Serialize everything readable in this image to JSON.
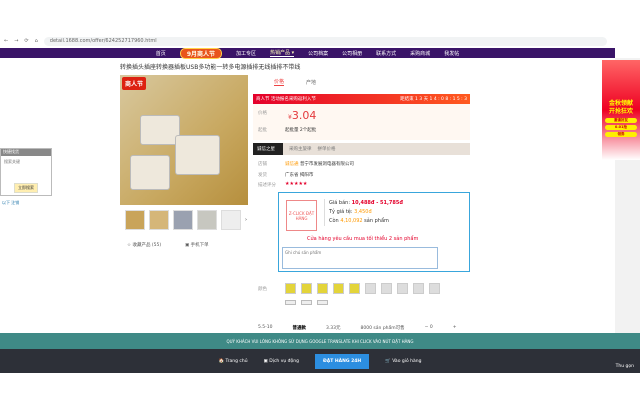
{
  "browser": {
    "url": "detail.1688.com/offer/624252717960.html"
  },
  "nav": {
    "items": [
      "首页",
      "9月商人节",
      "加工专区",
      "热销产品 ▾",
      "公司档案",
      "公司相册",
      "联系方式",
      "采购商城",
      "我发帖"
    ]
  },
  "product": {
    "title": "转换插头插座转换器插板USB多功能一转多电源插排无线插排不带线",
    "badge": "商人节",
    "tabs": [
      "价格",
      "产地"
    ],
    "promo_left": "商人节 活动报名采购返利入节",
    "promo_right": "距结束 1 3 天 1 4 : 0 8 : 1 5 : 3",
    "price_label": "价格",
    "currency": "¥",
    "price": "3.04",
    "stock_label": "起批",
    "stock_text": "起批量 2个起批",
    "seller_tag": "诚信之星",
    "seller_links": [
      "采购主旋律",
      "拼单价格"
    ],
    "shop_label": "店铺",
    "shop_name": "普宁市发展洞电器有限公司",
    "shop_badge": "诚信通",
    "place_label": "发货",
    "place": "广东省 揭阳市",
    "rating_label": "描述评分",
    "rating": "★★★★★",
    "collect": "☆ 收藏产品 (55)",
    "phone_order": "▣ 手机下单"
  },
  "order_box": {
    "logo": "Z-CLICK ĐẶT HÀNG",
    "price_label": "Giá bán: ",
    "price_range": "10,488đ - 51,785đ",
    "rate_label": "Tỷ giá tệ: ",
    "rate": "3,450đ",
    "stock_pre": "Còn ",
    "stock": "4,10,092",
    "stock_post": " sản phẩm",
    "requirement": "Cửa hàng yêu cầu mua tối thiểu 2 sản phẩm",
    "note_placeholder": "Ghi chú sản phẩm"
  },
  "options": {
    "color_label": "颜色",
    "qty_row": [
      "5.5-10",
      "普通款",
      "3.33元",
      "8000 sản phẩm可售",
      "−  0",
      "+"
    ]
  },
  "float_panel": {
    "title": "快捷找货",
    "field": "搜索关键",
    "button": "立即搜索",
    "link": "以下 注销"
  },
  "ad": {
    "headline": "金秋领献",
    "headline2": "开抢狂欢",
    "btn1": "邀请好友",
    "btn2": "0.01抢",
    "btn3": "领券"
  },
  "banner": "QUÝ KHÁCH VUI LÒNG KHÔNG SỬ DỤNG GOOGLE TRANSLATE KHI CLICK VÀO NÚT ĐẶT HÀNG",
  "bottom": {
    "home": "🏠 Trang chủ",
    "service": "▣ Dịch vụ động",
    "order": "ĐẶT HÀNG 24H",
    "cart": "🛒 Vào giỏ hàng",
    "collapse": "Thu gọn"
  }
}
